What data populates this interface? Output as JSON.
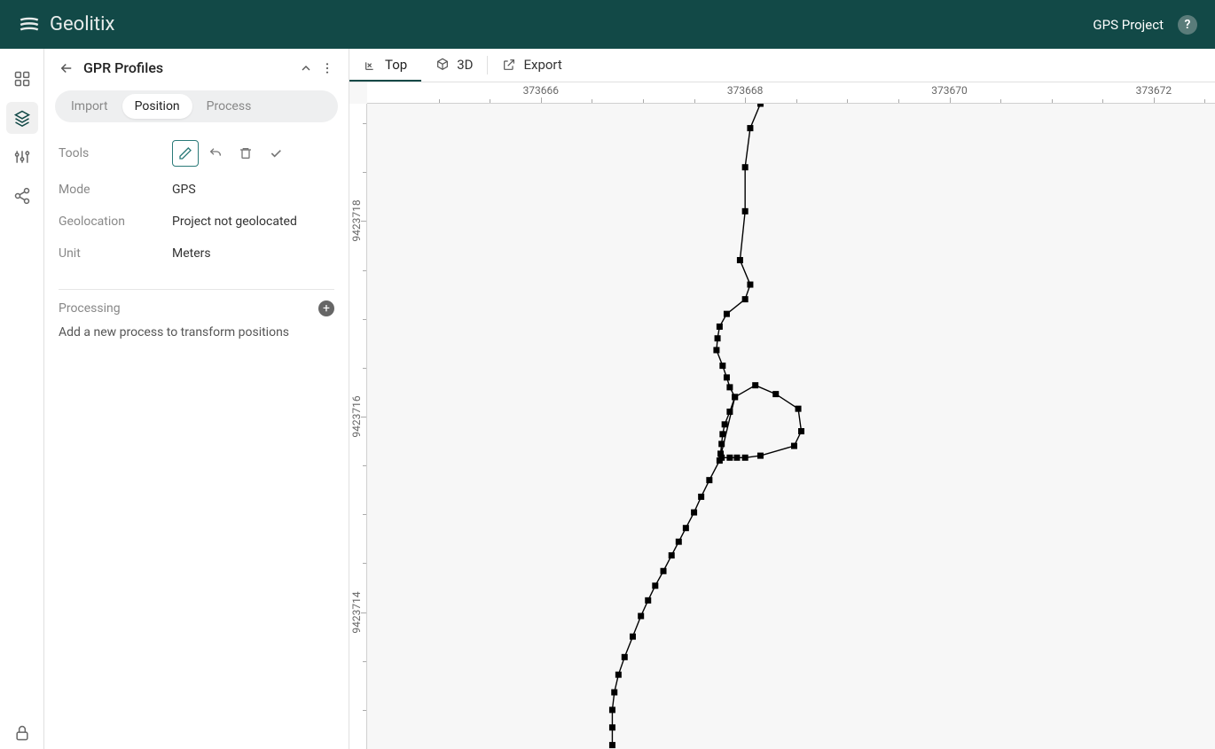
{
  "header": {
    "app_name": "Geolitix",
    "project_name": "GPS Project"
  },
  "sidebar": {
    "title": "GPR Profiles",
    "tabs": [
      "Import",
      "Position",
      "Process"
    ],
    "active_tab": "Position",
    "tools_label": "Tools",
    "mode_label": "Mode",
    "mode_value": "GPS",
    "geo_label": "Geolocation",
    "geo_value": "Project not geolocated",
    "unit_label": "Unit",
    "unit_value": "Meters",
    "processing_label": "Processing",
    "processing_hint": "Add a new process to transform positions"
  },
  "view_tabs": {
    "top": "Top",
    "three_d": "3D",
    "export": "Export"
  },
  "chart_data": {
    "type": "scatter",
    "xlabel": "",
    "ylabel": "",
    "x_ticks": [
      373666,
      373668,
      373670,
      373672
    ],
    "y_ticks": [
      9423714,
      9423716,
      9423718
    ],
    "xlim": [
      373664.3,
      373672.6
    ],
    "ylim": [
      9423712.6,
      9423719.2
    ],
    "points": [
      [
        373668.15,
        9423719.2
      ],
      [
        373668.05,
        9423718.95
      ],
      [
        373668.0,
        9423718.55
      ],
      [
        373668.0,
        9423718.1
      ],
      [
        373667.95,
        9423717.6
      ],
      [
        373668.05,
        9423717.35
      ],
      [
        373668.0,
        9423717.2
      ],
      [
        373667.82,
        9423717.05
      ],
      [
        373667.75,
        9423716.92
      ],
      [
        373667.73,
        9423716.8
      ],
      [
        373667.72,
        9423716.68
      ],
      [
        373667.78,
        9423716.52
      ],
      [
        373667.82,
        9423716.4
      ],
      [
        373667.85,
        9423716.3
      ],
      [
        373667.9,
        9423716.2
      ],
      [
        373667.85,
        9423716.05
      ],
      [
        373667.8,
        9423715.92
      ],
      [
        373667.78,
        9423715.82
      ],
      [
        373667.77,
        9423715.72
      ],
      [
        373667.76,
        9423715.62
      ],
      [
        373667.77,
        9423715.58
      ],
      [
        373667.85,
        9423715.58
      ],
      [
        373667.92,
        9423715.58
      ],
      [
        373668.0,
        9423715.58
      ],
      [
        373668.15,
        9423715.6
      ],
      [
        373668.48,
        9423715.7
      ],
      [
        373668.55,
        9423715.85
      ],
      [
        373668.52,
        9423716.08
      ],
      [
        373668.3,
        9423716.23
      ],
      [
        373668.1,
        9423716.32
      ],
      [
        373667.9,
        9423716.2
      ],
      [
        373667.75,
        9423715.55
      ],
      [
        373667.65,
        9423715.35
      ],
      [
        373667.57,
        9423715.18
      ],
      [
        373667.5,
        9423715.02
      ],
      [
        373667.42,
        9423714.86
      ],
      [
        373667.35,
        9423714.72
      ],
      [
        373667.28,
        9423714.58
      ],
      [
        373667.2,
        9423714.42
      ],
      [
        373667.12,
        9423714.27
      ],
      [
        373667.05,
        9423714.12
      ],
      [
        373666.98,
        9423713.96
      ],
      [
        373666.9,
        9423713.75
      ],
      [
        373666.82,
        9423713.54
      ],
      [
        373666.76,
        9423713.36
      ],
      [
        373666.72,
        9423713.18
      ],
      [
        373666.7,
        9423713.0
      ],
      [
        373666.7,
        9423712.82
      ],
      [
        373666.7,
        9423712.64
      ]
    ]
  }
}
